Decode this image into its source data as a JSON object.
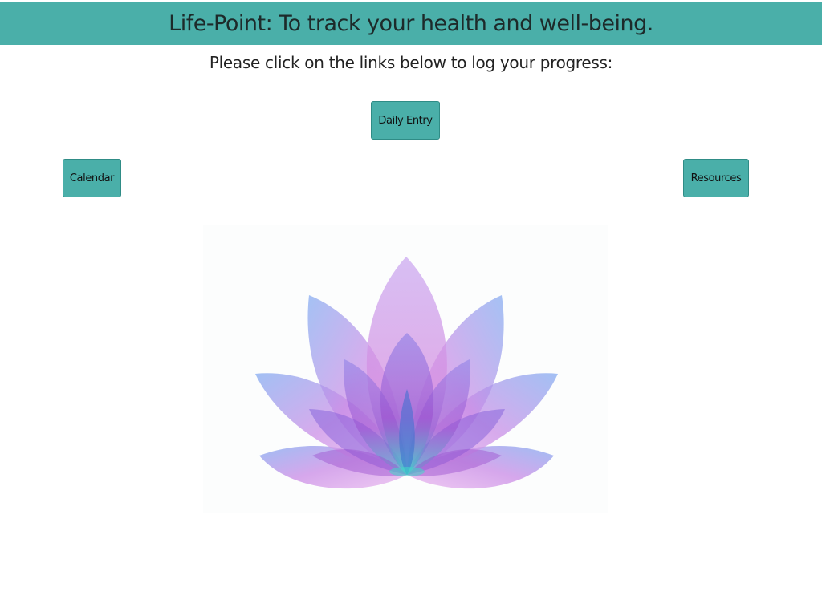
{
  "header": {
    "title": "Life-Point: To track your health and well-being."
  },
  "main": {
    "instruction": "Please click on the links below to log your progress:",
    "buttons": {
      "daily_entry": "Daily Entry",
      "calendar": "Calendar",
      "resources": "Resources"
    }
  },
  "colors": {
    "brand_teal": "#4aafa9",
    "petal_purple": "#b36be0",
    "petal_blue": "#7fa8f0",
    "petal_pink": "#e8b5ee",
    "lotus_center_teal": "#3fd9c9"
  },
  "image": {
    "icon": "lotus-flower-image"
  }
}
